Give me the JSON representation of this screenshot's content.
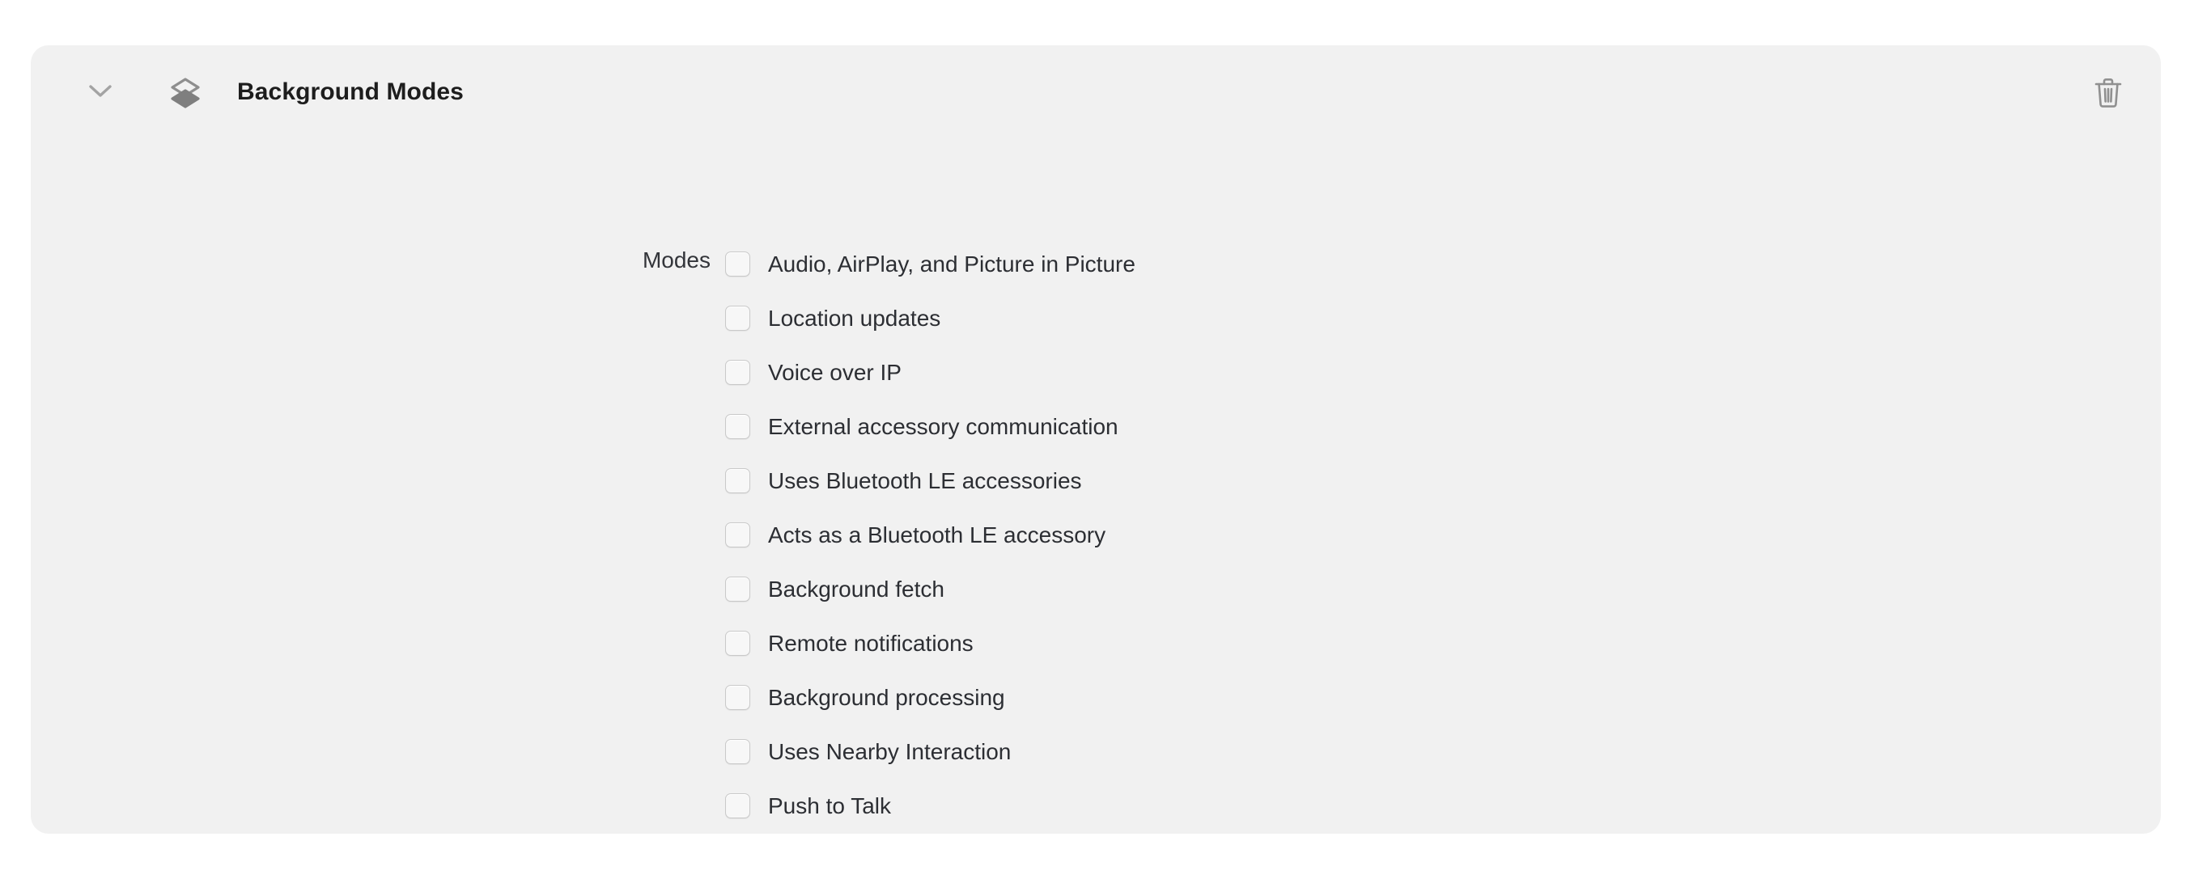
{
  "panel": {
    "title": "Background Modes",
    "expanded": true,
    "icons": {
      "disclosure": "chevron-down-icon",
      "section": "layers-stack-icon",
      "delete": "trash-icon"
    },
    "colors": {
      "panel_background": "#f1f1f1",
      "page_background": "#ffffff",
      "title_text": "#1d1d1d",
      "body_text": "#2c2e33",
      "label_text": "#33353a",
      "icon_gray": "#8e8e8e",
      "checkbox_border": "#c9c9c9",
      "checkbox_fill": "#f7f7f7"
    }
  },
  "field": {
    "label": "Modes",
    "modes": [
      {
        "label": "Audio, AirPlay, and Picture in Picture",
        "checked": false
      },
      {
        "label": "Location updates",
        "checked": false
      },
      {
        "label": "Voice over IP",
        "checked": false
      },
      {
        "label": "External accessory communication",
        "checked": false
      },
      {
        "label": "Uses Bluetooth LE accessories",
        "checked": false
      },
      {
        "label": "Acts as a Bluetooth LE accessory",
        "checked": false
      },
      {
        "label": "Background fetch",
        "checked": false
      },
      {
        "label": "Remote notifications",
        "checked": false
      },
      {
        "label": "Background processing",
        "checked": false
      },
      {
        "label": "Uses Nearby Interaction",
        "checked": false
      },
      {
        "label": "Push to Talk",
        "checked": false
      }
    ]
  }
}
